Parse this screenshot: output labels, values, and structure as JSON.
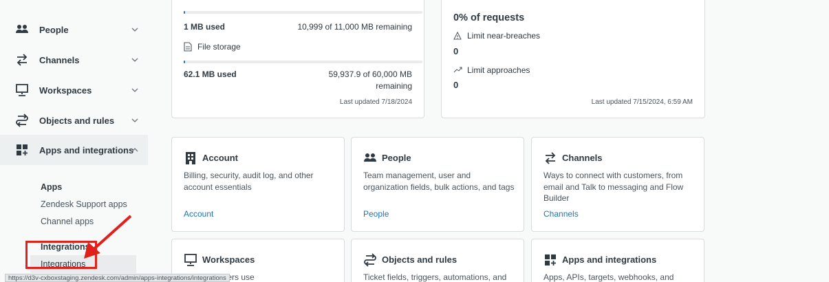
{
  "sidebar": {
    "items": [
      {
        "label": "People",
        "icon": "people-icon"
      },
      {
        "label": "Channels",
        "icon": "channels-icon"
      },
      {
        "label": "Workspaces",
        "icon": "workspaces-icon"
      },
      {
        "label": "Objects and rules",
        "icon": "objects-rules-icon"
      },
      {
        "label": "Apps and integrations",
        "icon": "apps-integrations-icon"
      }
    ],
    "apps_heading": "Apps",
    "apps_links": [
      "Zendesk Support apps",
      "Channel apps"
    ],
    "integrations_heading": "Integrations",
    "integrations_link": "Integrations"
  },
  "storage": {
    "data_used": "1 MB used",
    "data_progress": 0.0001,
    "data_remaining": "10,999 of 11,000 MB remaining",
    "file_label": "File storage",
    "file_used": "62.1 MB used",
    "file_progress": 0.001,
    "file_remaining_1": "59,937.9 of 60,000 MB",
    "file_remaining_2": "remaining",
    "updated": "Last updated 7/18/2024"
  },
  "requests": {
    "percent": "0% of requests",
    "breaches_label": "Limit near-breaches",
    "breaches_value": "0",
    "approaches_label": "Limit approaches",
    "approaches_value": "0",
    "updated": "Last updated 7/15/2024, 6:59 AM"
  },
  "cards": [
    {
      "title": "Account",
      "desc": "Billing, security, audit log, and other account essentials",
      "link": "Account"
    },
    {
      "title": "People",
      "desc": "Team management, user and organization fields, bulk actions, and tags",
      "link": "People"
    },
    {
      "title": "Channels",
      "desc": "Ways to connect with customers, from email and Talk to messaging and Flow Builder",
      "link": "Channels"
    },
    {
      "title": "Workspaces",
      "desc": "Ma... members use"
    },
    {
      "title": "Objects and rules",
      "desc": "Ticket fields, triggers, automations, and"
    },
    {
      "title": "Apps and integrations",
      "desc": "Apps, APIs, targets, webhooks, and"
    }
  ],
  "status_url": "https://d3v-cxboxstaging.zendesk.com/admin/apps-integrations/integrations",
  "colors": {
    "link": "#1f73b7",
    "highlight": "#e0201b",
    "progress": "#1f73b7"
  }
}
